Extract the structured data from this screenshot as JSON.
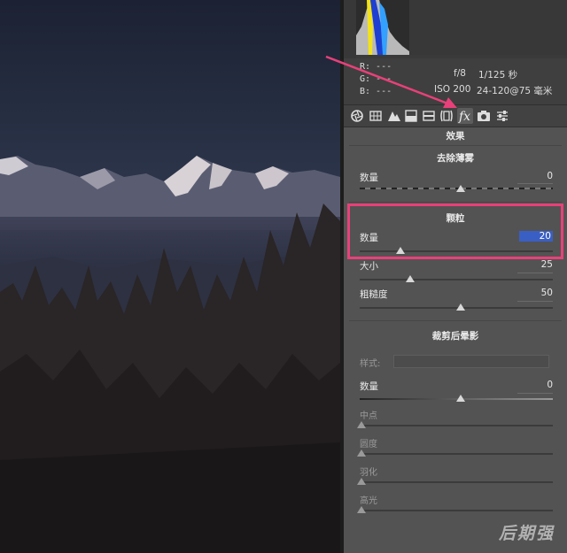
{
  "info": {
    "r": "R:   ---",
    "g": "G:   ---",
    "b": "B:   ---",
    "aperture": "f/8",
    "shutter": "1/125 秒",
    "iso": "ISO 200",
    "lens": "24-120@75 毫米"
  },
  "toolbar": {
    "icons": [
      "aperture-icon",
      "grid-icon",
      "mountain-icon",
      "split-panel-icon",
      "stripe-icon",
      "lens-icon",
      "fx-icon",
      "camera-icon",
      "sliders-icon"
    ],
    "active": "fx-icon"
  },
  "panel": {
    "header": "效果",
    "dehaze": {
      "title": "去除薄雾",
      "amount_label": "数量",
      "amount_value": "0",
      "amount": 0,
      "min": -100,
      "max": 100
    },
    "grain": {
      "title": "颗粒",
      "amount_label": "数量",
      "amount_value": "20",
      "amount": 20,
      "size_label": "大小",
      "size_value": "25",
      "size": 25,
      "roughness_label": "粗糙度",
      "roughness_value": "50",
      "roughness": 50
    },
    "vignette": {
      "title": "裁剪后晕影",
      "style_label": "样式:",
      "amount_label": "数量",
      "amount_value": "0",
      "amount": 0,
      "midpoint_label": "中点",
      "roundness_label": "圆度",
      "feather_label": "羽化",
      "highlights_label": "高光"
    }
  },
  "colors": {
    "highlight": "#e8407a",
    "selection": "#3a5fc4"
  },
  "watermark": "后期强"
}
